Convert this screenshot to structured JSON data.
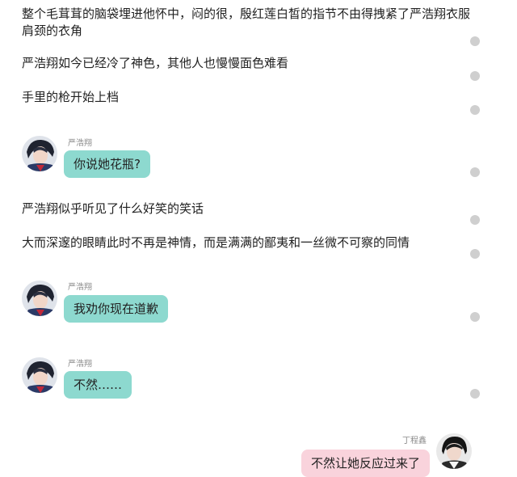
{
  "narration": [
    "整个毛茸茸的脑袋埋进他怀中，闷的很，殷红莲白皙的指节不由得拽紧了严浩翔衣服肩颈的衣角",
    "严浩翔如今已经冷了神色，其他人也慢慢面色难看",
    "手里的枪开始上档",
    "严浩翔似乎听见了什么好笑的笑话",
    "大而深邃的眼睛此时不再是神情，而是满满的鄙夷和一丝微不可察的同情"
  ],
  "messages": [
    {
      "speaker": "严浩翔",
      "text": "你说她花瓶?",
      "side": "left"
    },
    {
      "speaker": "严浩翔",
      "text": "我劝你现在道歉",
      "side": "left"
    },
    {
      "speaker": "严浩翔",
      "text": "不然……",
      "side": "left"
    },
    {
      "speaker": "丁程鑫",
      "text": "不然让她反应过来了",
      "side": "right"
    }
  ],
  "colors": {
    "left_bubble": "#8dd9cf",
    "right_bubble": "#f9d3dc",
    "dot": "#cfcfcf",
    "speaker_text": "#8a8a8a"
  }
}
